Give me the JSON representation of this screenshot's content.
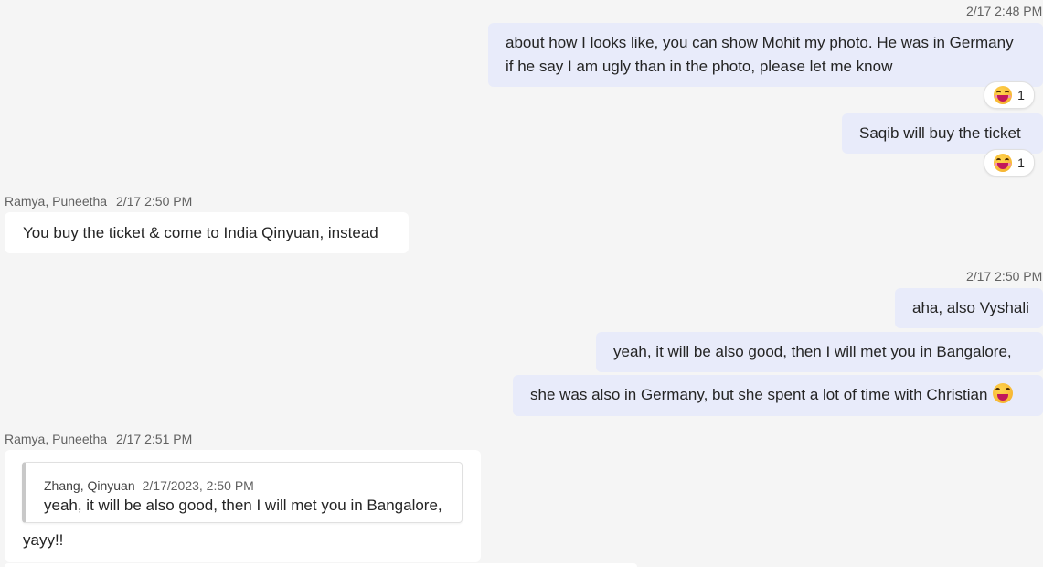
{
  "messages": {
    "group1_time": "2/17 2:48 PM",
    "msg1_line1": "about how I looks like, you can show Mohit my photo. He was in Germany",
    "msg1_line2": "if he say I am ugly than in the photo, please let me know",
    "msg1_reaction_count": "1",
    "msg2_text": "Saqib will buy the ticket",
    "msg2_reaction_count": "1",
    "other1_sender": "Ramya, Puneetha",
    "other1_time": "2/17 2:50 PM",
    "other1_text": "You buy the ticket & come to India Qinyuan, instead",
    "group2_time": "2/17 2:50 PM",
    "msg3_text": "aha, also Vyshali",
    "msg4_text": "yeah, it will be also good, then I will met you in Bangalore,",
    "msg5_text": "she was also in Germany, but she spent a lot of time with Christian",
    "other2_sender": "Ramya, Puneetha",
    "other2_time": "2/17 2:51 PM",
    "quote_author": "Zhang, Qinyuan",
    "quote_time": "2/17/2023, 2:50 PM",
    "quote_text": "yeah, it will be also good, then I will met you in Bangalore,",
    "other2_text": "yayy!!"
  },
  "icons": {
    "reaction_emoji": "laughing-face-icon",
    "inline_emoji": "grinning-face-icon"
  },
  "colors": {
    "background": "#f5f5f5",
    "self_bubble": "#e8ebfa",
    "other_bubble": "#ffffff",
    "meta_text": "#616161"
  }
}
